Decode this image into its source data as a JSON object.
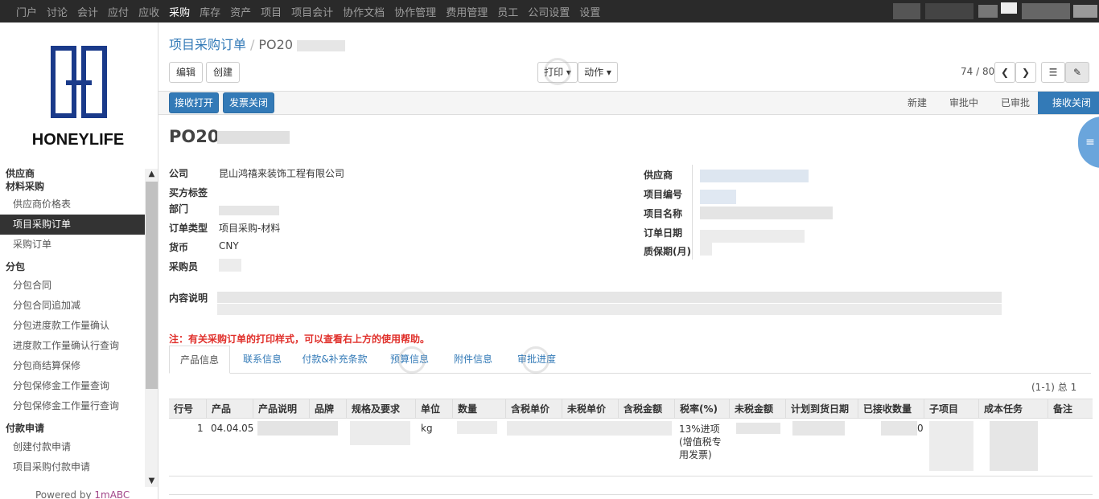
{
  "topnav": [
    "门户",
    "讨论",
    "会计",
    "应付",
    "应收",
    "采购",
    "库存",
    "资产",
    "项目",
    "项目会计",
    "协作文档",
    "协作管理",
    "费用管理",
    "员工",
    "公司设置",
    "设置"
  ],
  "topnav_active": "采购",
  "logo_text": "HONEYLIFE",
  "sidebar": {
    "groups": [
      {
        "title": "供应商",
        "items": []
      },
      {
        "title": "材料采购",
        "items": [
          "供应商价格表",
          "项目采购订单",
          "采购订单"
        ]
      },
      {
        "title": "分包",
        "items": [
          "分包合同",
          "分包合同追加减",
          "分包进度款工作量确认",
          "进度款工作量确认行查询",
          "分包商结算保修",
          "分包保修金工作量查询",
          "分包保修金工作量行查询"
        ]
      },
      {
        "title": "付款申请",
        "items": [
          "创建付款申请",
          "项目采购付款申请"
        ]
      }
    ],
    "selected": "项目采购订单",
    "powered_prefix": "Powered by ",
    "powered_brand": "1mABC"
  },
  "breadcrumb": {
    "parent": "项目采购订单",
    "sep": "/",
    "current": "PO20"
  },
  "toolbar": {
    "edit": "编辑",
    "create": "创建",
    "print": "打印",
    "action": "动作",
    "pager": "74 / 80"
  },
  "statusbar": {
    "btn_receive_open": "接收打开",
    "btn_invoice_close": "发票关闭",
    "stages": [
      "新建",
      "审批中",
      "已审批",
      "接收关闭"
    ],
    "active_stage": "接收关闭"
  },
  "record": {
    "title": "PO20",
    "left": [
      {
        "label": "公司",
        "value": "昆山鸿禧来装饰工程有限公司"
      },
      {
        "label": "买方标签",
        "value": ""
      },
      {
        "label": "部门",
        "value": ""
      },
      {
        "label": "订单类型",
        "value": "项目采购-材料"
      },
      {
        "label": "货币",
        "value": "CNY"
      },
      {
        "label": "采购员",
        "value": ""
      }
    ],
    "right_labels": [
      "供应商",
      "项目编号",
      "项目名称",
      "订单日期",
      "质保期(月)"
    ],
    "content_label": "内容说明",
    "note": "注：有关采购订单的打印样式，可以查看右上方的使用帮助。"
  },
  "tabs": [
    "产品信息",
    "联系信息",
    "付款&补充条款",
    "预算信息",
    "附件信息",
    "审批进度"
  ],
  "active_tab": "产品信息",
  "table": {
    "count": "(1-1) 总 1",
    "headers": [
      "行号",
      "产品",
      "产品说明",
      "品牌",
      "规格及要求",
      "单位",
      "数量",
      "含税单价",
      "未税单价",
      "含税金额",
      "税率(%)",
      "未税金额",
      "计划到货日期",
      "已接收数量",
      "子项目",
      "成本任务",
      "备注"
    ],
    "row": {
      "line": "1",
      "product": "04.04.05",
      "unit": "kg",
      "tax": "13%进项(增值税专用发票)",
      "received_suffix": "0"
    }
  },
  "colors": {
    "topbar": "#2a2a2a",
    "accent": "#337ab7",
    "warning": "#e0302b"
  }
}
